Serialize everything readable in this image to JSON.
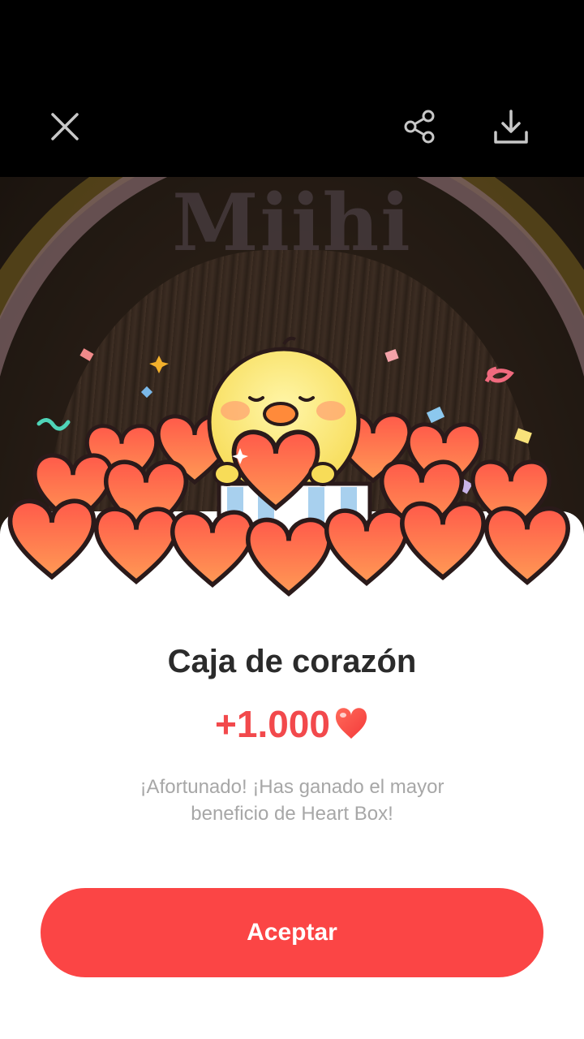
{
  "toolbar": {
    "close_icon": "close-icon",
    "share_icon": "share-icon",
    "download_icon": "download-icon"
  },
  "photo": {
    "watermark_text": "Miihi"
  },
  "dialog": {
    "title": "Caja de corazón",
    "reward_amount": "+1.000",
    "reward_icon": "heart-icon",
    "message_line1": "¡Afortunado! ¡Has ganado el mayor",
    "message_line2": "beneficio de Heart Box!",
    "accept_label": "Aceptar",
    "accent_color": "#fb4545"
  }
}
